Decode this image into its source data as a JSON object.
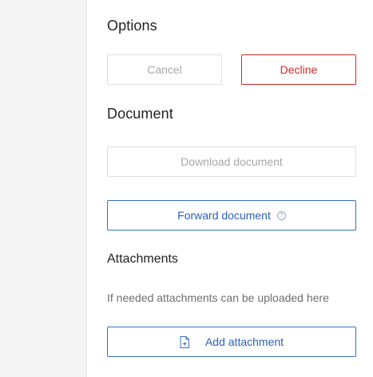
{
  "options": {
    "title": "Options",
    "cancel_label": "Cancel",
    "decline_label": "Decline"
  },
  "document": {
    "title": "Document",
    "download_label": "Download document",
    "forward_label": "Forward document",
    "forward_help_icon": "question-circle-icon"
  },
  "attachments": {
    "title": "Attachments",
    "hint": "If needed attachments can be uploaded here",
    "add_label": "Add attachment",
    "add_icon": "file-plus-icon"
  },
  "colors": {
    "danger": "#cf2b2b",
    "primary": "#2c5fb6",
    "disabled_text": "#a8a8a8"
  }
}
